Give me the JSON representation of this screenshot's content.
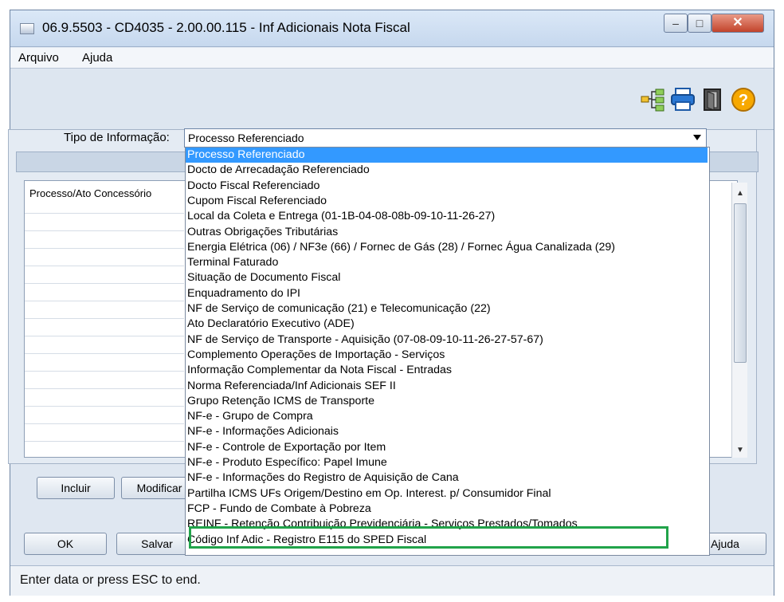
{
  "window": {
    "title": "06.9.5503 - CD4035 - 2.00.00.115 - Inf Adicionais Nota Fiscal"
  },
  "menu": {
    "items": [
      "Arquivo",
      "Ajuda"
    ]
  },
  "toolbar": {
    "icons": [
      "tree-structure-icon",
      "printer-icon",
      "exit-door-icon",
      "help-question-icon"
    ]
  },
  "form": {
    "tipo_label": "Tipo de Informação:",
    "tipo_value": "Processo Referenciado"
  },
  "grid": {
    "header": "Processo/Ato Concessório"
  },
  "buttons": {
    "incluir": "Incluir",
    "modificar": "Modificar",
    "ok": "OK",
    "salvar": "Salvar",
    "ajuda": "Ajuda"
  },
  "dropdown": {
    "options": [
      "Processo Referenciado",
      "Docto de Arrecadação Referenciado",
      "Docto Fiscal Referenciado",
      "Cupom Fiscal Referenciado",
      "Local da Coleta e Entrega (01-1B-04-08-08b-09-10-11-26-27)",
      "Outras Obrigações Tributárias",
      "Energia Elétrica (06) / NF3e (66) / Fornec de Gás (28) / Fornec Água Canalizada (29)",
      "Terminal Faturado",
      "Situação de Documento Fiscal",
      "Enquadramento do IPI",
      "NF de Serviço de comunicação (21) e Telecomunicação (22)",
      "Ato Declaratório Executivo (ADE)",
      "NF de Serviço de Transporte - Aquisição (07-08-09-10-11-26-27-57-67)",
      "Complemento Operações de Importação - Serviços",
      "Informação Complementar da Nota Fiscal - Entradas",
      "Norma Referenciada/Inf Adicionais SEF II",
      "Grupo Retenção ICMS de Transporte",
      "NF-e - Grupo de Compra",
      "NF-e - Informações Adicionais",
      "NF-e - Controle de Exportação por Item",
      "NF-e - Produto Específico: Papel Imune",
      "NF-e - Informações do Registro de Aquisição de Cana",
      "Partilha ICMS UFs Origem/Destino em Op. Interest. p/ Consumidor Final",
      "FCP - Fundo de Combate à Pobreza",
      "REINF - Retenção Contribuição Previdenciária - Serviços Prestados/Tomados",
      "Código Inf Adic - Registro E115 do SPED Fiscal"
    ],
    "selected_index": 0,
    "highlighted_index": 24
  },
  "status": {
    "text": "Enter data or press ESC to end."
  },
  "colors": {
    "selection": "#3399ff",
    "highlight_box": "#21a34a"
  }
}
